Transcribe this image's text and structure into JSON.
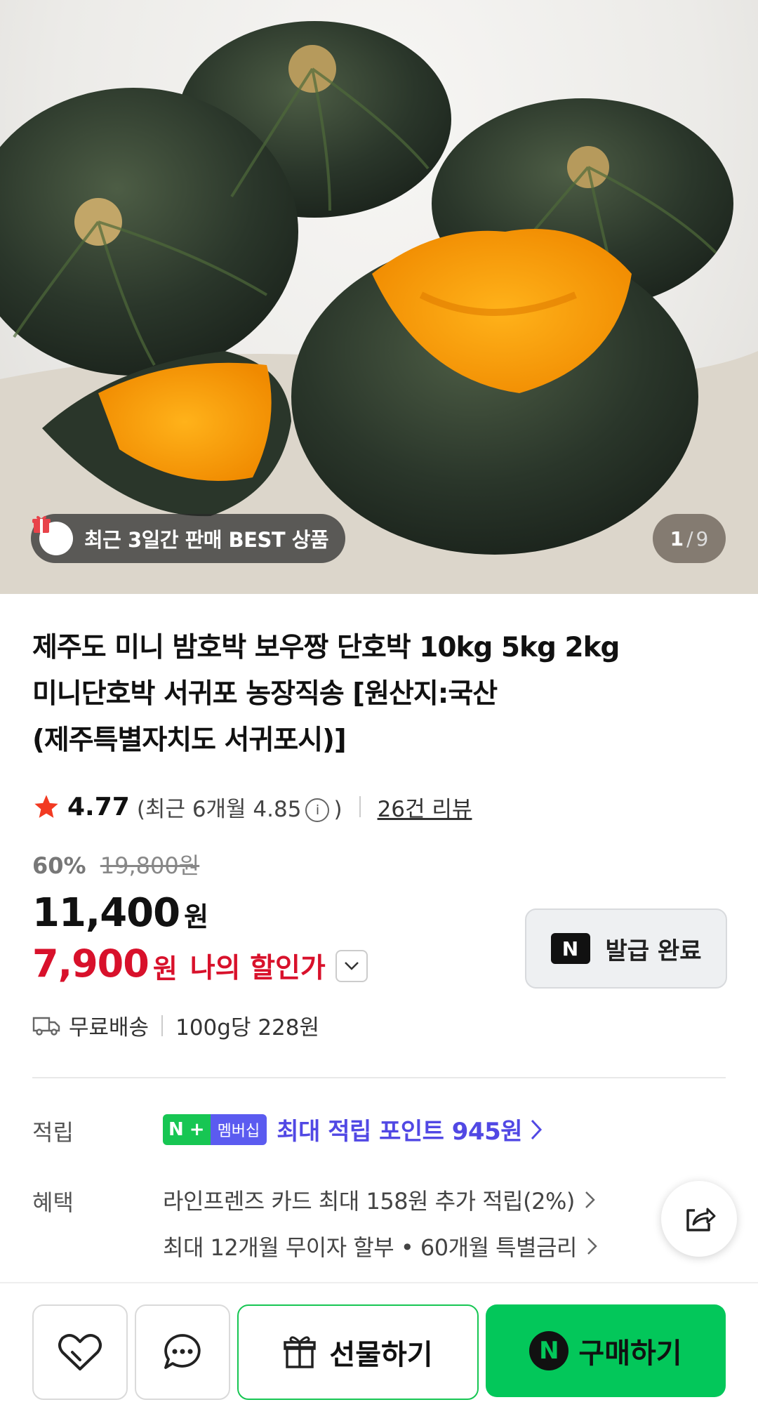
{
  "gallery": {
    "badge": "최근 3일간 판매 BEST 상품",
    "current": "1",
    "separator": "/",
    "total": "9"
  },
  "product": {
    "title_lines": [
      "제주도 미니 밤호박 보우짱 단호박 10kg 5kg 2kg",
      "미니단호박 서귀포 농장직송 [원산지:국산",
      "(제주특별자치도 서귀포시)]"
    ],
    "rating": "4.77",
    "recent_rating_prefix": "(최근 6개월 4.85",
    "recent_rating_suffix": ")",
    "review_link": "26건 리뷰",
    "discount_pct": "60%",
    "original_price": "19,800원",
    "price": "11,400",
    "price_unit": "원",
    "my_price": "7,900",
    "my_price_unit": "원",
    "my_price_label": "나의 할인가",
    "coupon_button": "발급 완료",
    "shipping": "무료배송",
    "unit_price": "100g당 228원"
  },
  "points": {
    "label": "적립",
    "membership_badge_n": "N",
    "membership_badge_plus": "+",
    "membership_badge_text": "멤버십",
    "text": "최대 적립 포인트 945원"
  },
  "benefits": {
    "label": "혜택",
    "items": [
      "라인프렌즈 카드 최대 158원 추가 적립(2%)",
      "최대 12개월 무이자 할부 • 60개월 특별금리"
    ]
  },
  "bottom": {
    "gift_label": "선물하기",
    "buy_label": "구매하기",
    "buy_n": "N"
  },
  "colors": {
    "accent_red": "#d8112b",
    "naver_green": "#03c75a",
    "point_purple": "#5148e4"
  }
}
